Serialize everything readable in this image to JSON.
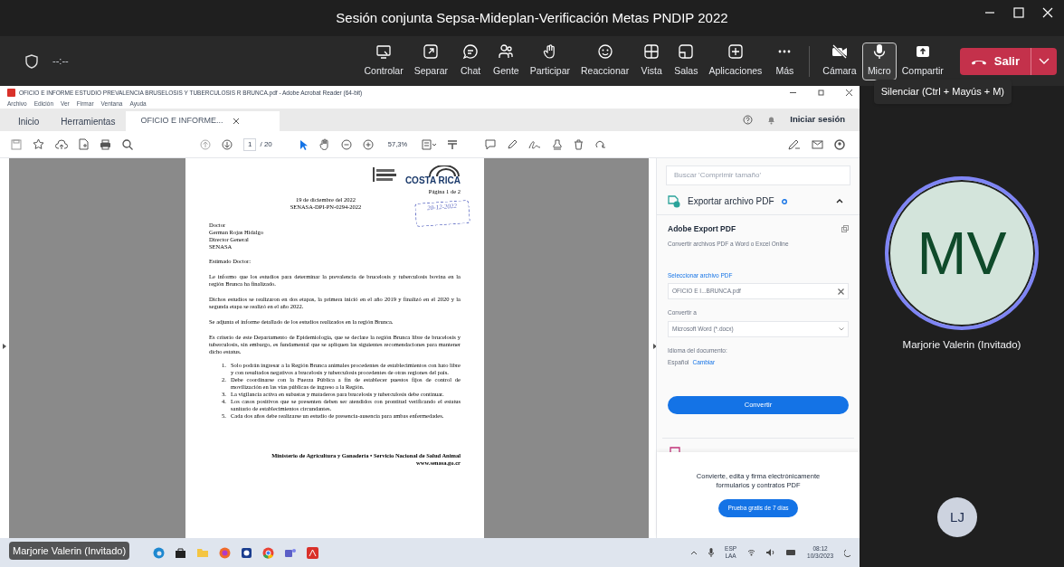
{
  "meeting": {
    "title": "Sesión conjunta Sepsa-Mideplan-Verificación Metas PNDIP 2022",
    "timer": "--:--"
  },
  "toolbar": {
    "buttons": [
      {
        "label": "Controlar",
        "selected": false
      },
      {
        "label": "Separar",
        "selected": false
      },
      {
        "label": "Chat",
        "selected": false
      },
      {
        "label": "Gente",
        "selected": false
      },
      {
        "label": "Participar",
        "selected": false
      },
      {
        "label": "Reaccionar",
        "selected": false
      },
      {
        "label": "Vista",
        "selected": false
      },
      {
        "label": "Salas",
        "selected": false
      },
      {
        "label": "Aplicaciones",
        "selected": false
      },
      {
        "label": "Más",
        "selected": false
      },
      {
        "label": "Cámara",
        "selected": false
      },
      {
        "label": "Micro",
        "selected": true
      },
      {
        "label": "Compartir",
        "selected": false
      }
    ],
    "leave": "Salir"
  },
  "tooltip": "Silenciar (Ctrl + Mayús + M)",
  "acrobat": {
    "title": "OFICIO E INFORME ESTUDIO PREVALENCIA BRUSELOSIS Y TUBERCULOSIS R BRUNCA.pdf - Adobe Acrobat Reader (64-bit)",
    "menu": [
      "Archivo",
      "Edición",
      "Ver",
      "Firmar",
      "Ventana",
      "Ayuda"
    ],
    "tabs": [
      {
        "label": "Inicio",
        "selected": false
      },
      {
        "label": "Herramientas",
        "selected": false
      },
      {
        "label": "OFICIO E INFORME...",
        "selected": true
      }
    ],
    "sign_in": "Iniciar sesión",
    "page": "1",
    "page_total": "/ 20",
    "zoom": "57,3%",
    "document": {
      "logo": "COSTA RICA",
      "page_label": "Página 1 de 2",
      "date": "19 de diciembre del 2022",
      "reference": "SENASA-DPI-PN-0294-2022",
      "stamp": "20-12-2022",
      "address": [
        "Doctor",
        "German Rojas Hidalgo",
        "Director General",
        "SENASA"
      ],
      "greeting": "Estimado Doctor:",
      "paragraphs": [
        "Le informo que los estudios para determinar la prevalencia de brucelosis y tuberculosis bovina en la región Brunca ha finalizado.",
        "Dichos estudios se realizaron en dos etapas, la primera inició en el año 2019 y finalizó en el 2020 y la segunda etapa se realizó en el año 2022.",
        "Se adjunta el informe detallado de los estudios realizados en la región Brunca.",
        "Es criterio de este Departamento de Epidemiología, que se declare la región Brunca libre de brucelosis y tuberculosis, sin embargo, es fundamental que se apliquen las siguientes recomendaciones para mantener dicho estatus."
      ],
      "list": [
        {
          "number": "1.",
          "text": "Solo podrán ingresar a la Región Brunca animales procedentes de establecimientos con hato libre y con resultados negativos a brucelosis y tuberculosis procedentes de otras regiones del país."
        },
        {
          "number": "2.",
          "text": "Debe coordinarse con la Fuerza Pública a fin de establecer puestos fijos de control de movilización en las vías públicas de ingreso a la Región."
        },
        {
          "number": "3.",
          "text": "La vigilancia activa en subastas y mataderos para brucelosis y tuberculosis debe continuar."
        },
        {
          "number": "4.",
          "text": "Los casos positivos que se presenten deben ser atendidos con prontitud verificando el estatus sanitario de establecimientos circundantes."
        },
        {
          "number": "5.",
          "text": "Cada dos años debe realizarse un estudio de presencia-ausencia para ambas enfermedades."
        }
      ],
      "footer": [
        "Ministerio de Agricultura y Ganadería • Servicio Nacional de Salud Animal",
        "www.senasa.go.cr"
      ]
    },
    "pane": {
      "search_placeholder": "Buscar 'Comprimir tamaño'",
      "section": "Exportar archivo PDF",
      "expanded": true,
      "heading": "Adobe Export PDF",
      "description": "Convertir archivos PDF a Word o Excel Online",
      "file_label": "Seleccionar archivo PDF",
      "file": "OFICIO E I...BRUNCA.pdf",
      "convert_label": "Convertir a",
      "format": "Microsoft Word (*.docx)",
      "language_label": "Idioma del documento:",
      "language": "Español",
      "change": "Cambiar",
      "convert_button": "Convertir",
      "promo": "Convierte, edita y firma electrónicamente formularios y contratos PDF",
      "trial_button": "Prueba gratis de 7 días"
    }
  },
  "share_label": "Marjorie Valerin (Invitado)",
  "taskbar": {
    "language": "ESP",
    "layout": "LAA",
    "time": "08:12",
    "date": "10/3/2023"
  },
  "participants": [
    {
      "initials": "MV",
      "name": "Marjorie Valerin (Invitado)",
      "speaking": true
    },
    {
      "initials": "LJ",
      "speaking": false
    }
  ]
}
